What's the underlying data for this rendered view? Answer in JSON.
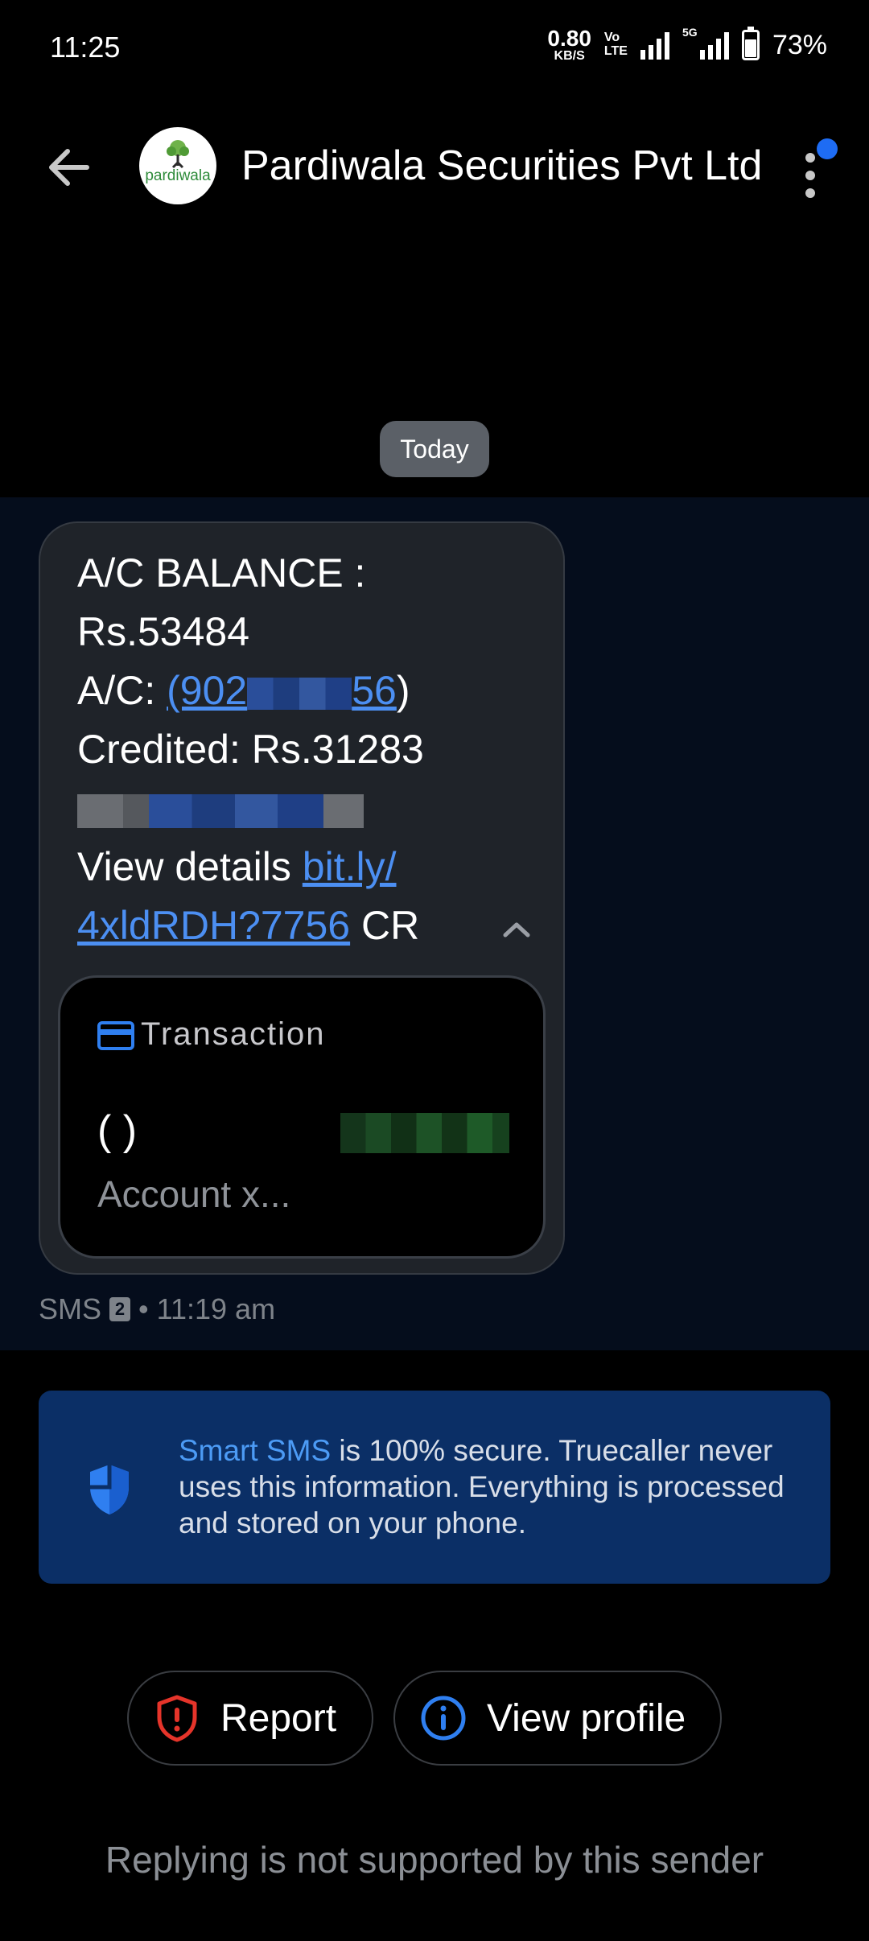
{
  "status_bar": {
    "time": "11:25",
    "net_speed_value": "0.80",
    "net_speed_unit": "KB/S",
    "volte_line1": "Vo",
    "volte_line2": "LTE",
    "fiveg_label": "5G",
    "battery": "73%"
  },
  "header": {
    "sender_name": "Pardiwala Securities Pvt Ltd",
    "avatar_text": "pardiwala"
  },
  "date_divider": "Today",
  "message": {
    "line1": "A/C BALANCE :",
    "line2": "Rs.53484",
    "line3_prefix": "A/C: ",
    "account_link_start": "(902",
    "account_link_end": "56",
    "line3_suffix": ")",
    "line4": "Credited: Rs.31283",
    "line6_prefix": "View details ",
    "link_part1": "bit.ly/",
    "link_part2": "4xldRDH?7756",
    "line7_suffix": " CR"
  },
  "transaction_card": {
    "title": "Transaction",
    "parens": "( )",
    "account": "Account x..."
  },
  "meta": {
    "type": "SMS",
    "sim": "2",
    "separator": "•",
    "time": "11:19 am"
  },
  "info_card": {
    "brand": "Smart SMS",
    "text": " is 100% secure. Truecaller never uses this information. Everything is processed and stored on your phone."
  },
  "actions": {
    "report": "Report",
    "view_profile": "View profile"
  },
  "reply_note": "Replying is not supported by this sender",
  "colors": {
    "accent_blue": "#4c8ff2",
    "info_card_bg": "#0b2f66",
    "report_red": "#e5342a",
    "bubble_bg": "#1f2329"
  }
}
